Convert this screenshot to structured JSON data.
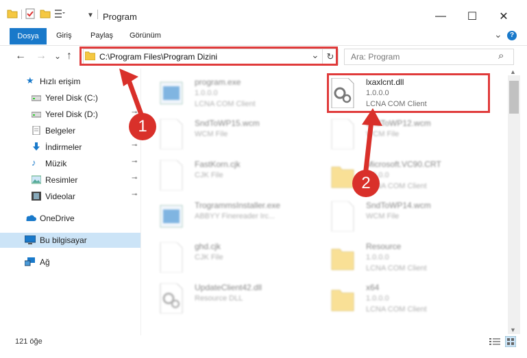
{
  "window": {
    "title": "Program",
    "minimize_glyph": "—",
    "maximize_glyph": "☐",
    "close_glyph": "✕"
  },
  "ribbon": {
    "tabs": [
      "Dosya",
      "Giriş",
      "Paylaş",
      "Görünüm"
    ],
    "expand_glyph": "⌄",
    "help_glyph": "?"
  },
  "address": {
    "path": "C:\\Program Files\\Program Dizini",
    "dropdown_glyph": "⌄",
    "refresh_glyph": "↻"
  },
  "search": {
    "placeholder": "Ara: Program",
    "icon_glyph": "⌕"
  },
  "nav": {
    "back": "←",
    "forward": "→",
    "recent": "⌄",
    "up": "↑"
  },
  "sidebar": {
    "items": [
      {
        "label": "Hızlı erişim",
        "icon": "star-icon",
        "pinned": false
      },
      {
        "label": "Yerel Disk (C:)",
        "icon": "drive-icon",
        "pinned": true
      },
      {
        "label": "Yerel Disk (D:)",
        "icon": "drive-icon",
        "pinned": true
      },
      {
        "label": "Belgeler",
        "icon": "documents-icon",
        "pinned": true
      },
      {
        "label": "İndirmeler",
        "icon": "download-icon",
        "pinned": true
      },
      {
        "label": "Müzik",
        "icon": "music-icon",
        "pinned": true
      },
      {
        "label": "Resimler",
        "icon": "pictures-icon",
        "pinned": true
      },
      {
        "label": "Videolar",
        "icon": "videos-icon",
        "pinned": true
      },
      {
        "label": "OneDrive",
        "icon": "cloud-icon",
        "pinned": false
      },
      {
        "label": "Bu bilgisayar",
        "icon": "computer-icon",
        "pinned": false,
        "selected": true
      },
      {
        "label": "Ağ",
        "icon": "network-icon",
        "pinned": false
      }
    ],
    "pin_glyph": "📌"
  },
  "files": [
    {
      "name": "program.exe",
      "line1": "1.0.0.0",
      "line2": "LCNA COM Client",
      "blurred": true
    },
    {
      "name": "lxaxlcnt.dll",
      "line1": "1.0.0.0",
      "line2": "LCNA COM Client",
      "blurred": false
    },
    {
      "name": "SndToWP15.wcm",
      "line1": "WCM File",
      "line2": "",
      "blurred": true
    },
    {
      "name": "SndToWP12.wcm",
      "line1": "WCM File",
      "line2": "",
      "blurred": true
    },
    {
      "name": "FastKorn.cjk",
      "line1": "CJK File",
      "line2": "",
      "blurred": true
    },
    {
      "name": "Microsoft.VC90.CRT",
      "line1": "1.0.0.0",
      "line2": "LCNA COM Client",
      "blurred": true
    },
    {
      "name": "TrogrammsInstaller.exe",
      "line1": "ABBYY Finereader Irc...",
      "line2": "",
      "blurred": true
    },
    {
      "name": "SndToWP14.wcm",
      "line1": "WCM File",
      "line2": "",
      "blurred": true
    },
    {
      "name": "ghd.cjk",
      "line1": "CJK File",
      "line2": "",
      "blurred": true
    },
    {
      "name": "Resource",
      "line1": "1.0.0.0",
      "line2": "LCNA COM Client",
      "blurred": true
    },
    {
      "name": "UpdateClient42.dll",
      "line1": "Resource DLL",
      "line2": "",
      "blurred": true
    },
    {
      "name": "x64",
      "line1": "1.0.0.0",
      "line2": "LCNA COM Client",
      "blurred": true
    }
  ],
  "annotations": {
    "step1": "1",
    "step2": "2"
  },
  "status": {
    "item_count": "121 öğe"
  },
  "colors": {
    "accent": "#1979ca",
    "highlight": "#e03a3a",
    "badge": "#d9302a"
  }
}
